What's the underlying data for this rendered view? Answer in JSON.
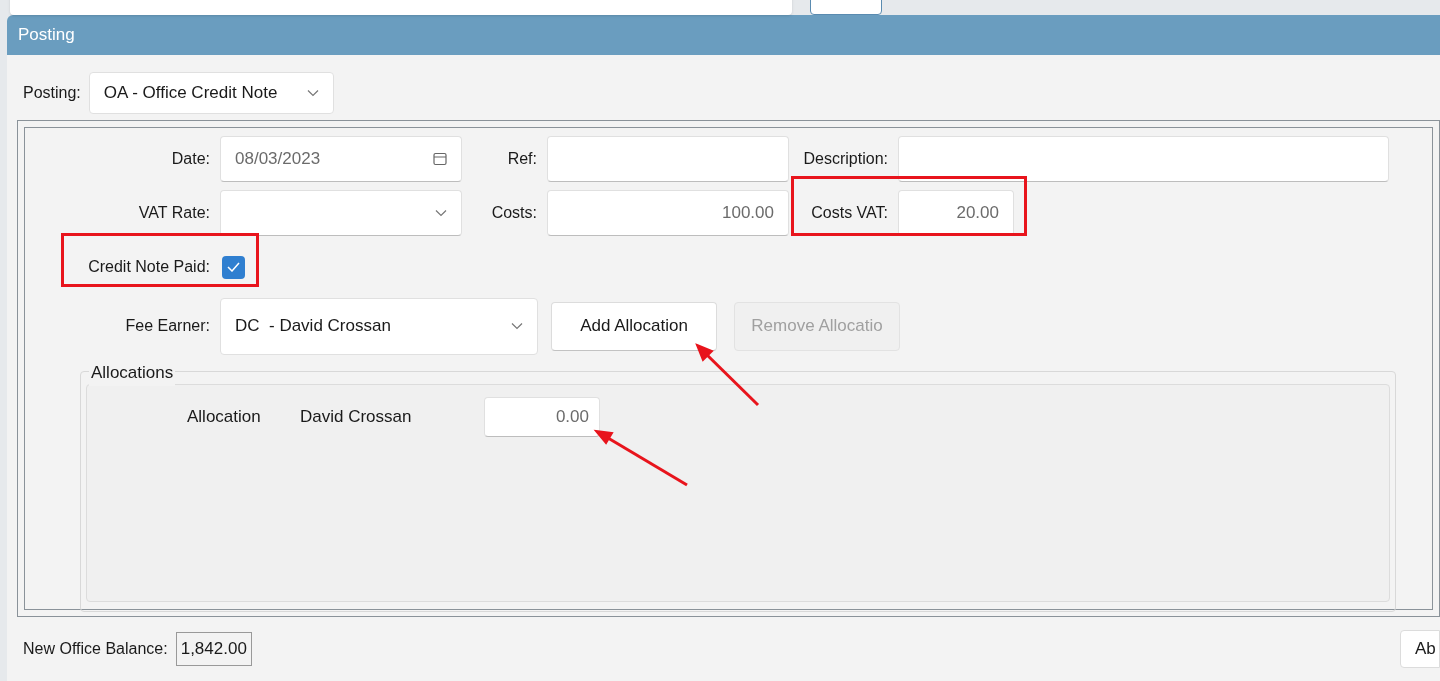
{
  "panel": {
    "title": "Posting"
  },
  "posting": {
    "label": "Posting:",
    "value": "OA - Office Credit Note"
  },
  "rows": [
    [
      {
        "kind": "date",
        "label": "Date:",
        "value": "08/03/2023"
      },
      {
        "kind": "text",
        "label": "Ref:"
      },
      {
        "kind": "text",
        "label": "Description:"
      }
    ],
    [
      {
        "kind": "select",
        "label": "VAT Rate:"
      },
      {
        "kind": "number",
        "label": "Costs:",
        "value": "100.00"
      },
      {
        "kind": "number",
        "label": "Costs VAT:",
        "value": "20.00"
      }
    ]
  ],
  "credit_note_paid": {
    "label": "Credit Note Paid:",
    "checked": true
  },
  "fee_earner": {
    "label": "Fee Earner:",
    "value": "DC  - David Crossan"
  },
  "buttons": [
    {
      "label": "Add Allocation",
      "disabled": false
    },
    {
      "label": "Remove Allocatio",
      "disabled": true
    }
  ],
  "allocations": {
    "title": "Allocations",
    "rows": [
      {
        "label": "Allocation",
        "name": "David Crossan",
        "value": "0.00"
      }
    ]
  },
  "balance": {
    "label": "New Office Balance:",
    "value": "1,842.00"
  },
  "right_button": {
    "label": "Ab"
  }
}
